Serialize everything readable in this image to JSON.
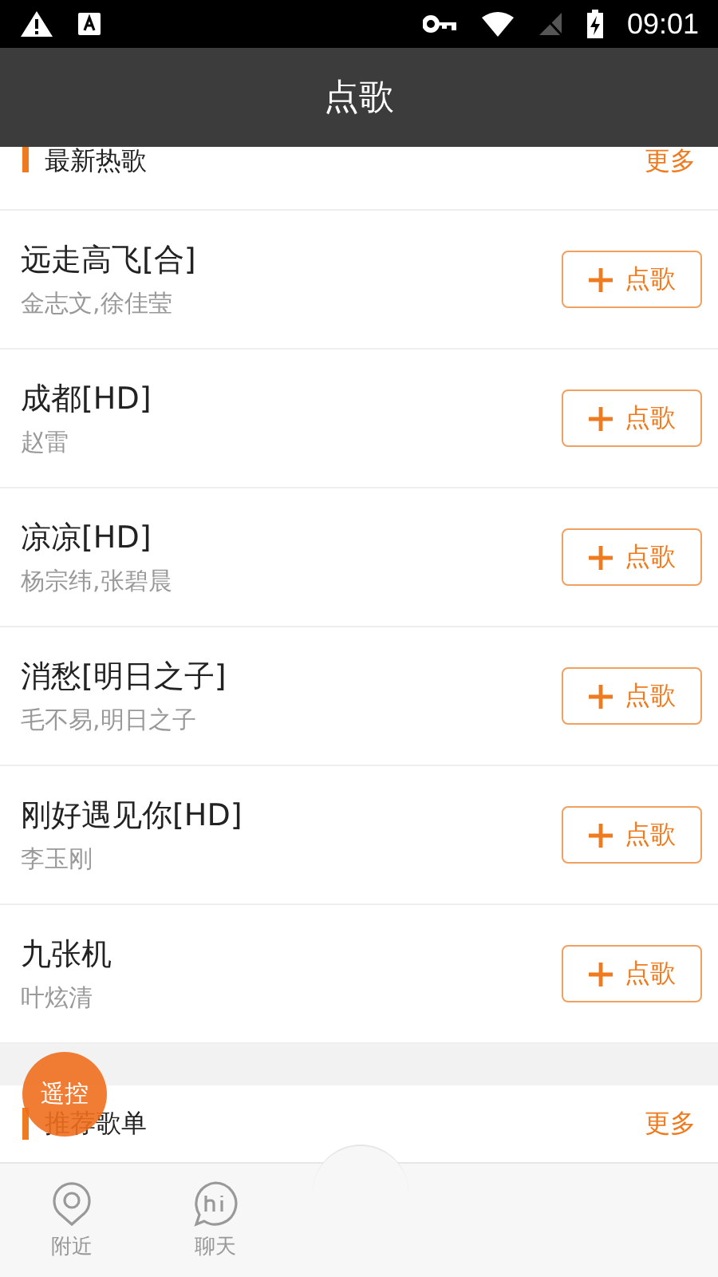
{
  "status_bar": {
    "time": "09:01"
  },
  "title": "点歌",
  "sections": [
    {
      "title": "最新热歌",
      "more": "更多"
    }
  ],
  "songs": [
    {
      "title": "远走高飞[合]",
      "artist": "金志文,徐佳莹",
      "action": "点歌"
    },
    {
      "title": "成都[HD]",
      "artist": "赵雷",
      "action": "点歌"
    },
    {
      "title": "凉凉[HD]",
      "artist": "杨宗纬,张碧晨",
      "action": "点歌"
    },
    {
      "title": "消愁[明日之子]",
      "artist": "毛不易,明日之子",
      "action": "点歌"
    },
    {
      "title": "刚好遇见你[HD]",
      "artist": "李玉刚",
      "action": "点歌"
    },
    {
      "title": "九张机",
      "artist": "叶炫清",
      "action": "点歌"
    }
  ],
  "section2": {
    "title": "推荐歌单",
    "more": "更多"
  },
  "floating_button": "遥控",
  "tabs": [
    {
      "label": "附近",
      "kind": "pin",
      "selected": false
    },
    {
      "label": "聊天",
      "kind": "chat",
      "selected": false
    }
  ]
}
